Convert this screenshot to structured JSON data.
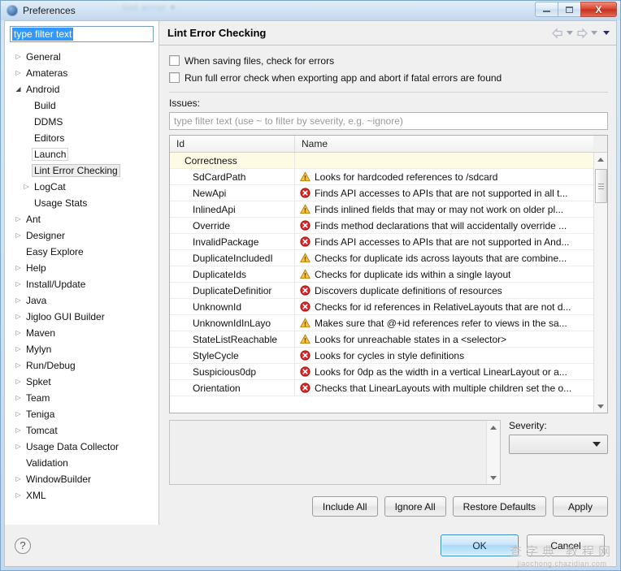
{
  "window": {
    "title": "Preferences",
    "ghost_text": "lint error  ▾",
    "minimize_label": "Minimize",
    "maximize_label": "Maximize",
    "close_label": "X"
  },
  "sidebar": {
    "filter_value": "type filter text",
    "items": [
      {
        "label": "General",
        "indent": 0,
        "arrow": "collapsed",
        "state": "normal"
      },
      {
        "label": "Amateras",
        "indent": 0,
        "arrow": "collapsed",
        "state": "normal"
      },
      {
        "label": "Android",
        "indent": 0,
        "arrow": "expanded",
        "state": "normal"
      },
      {
        "label": "Build",
        "indent": 1,
        "arrow": "none",
        "state": "normal"
      },
      {
        "label": "DDMS",
        "indent": 1,
        "arrow": "none",
        "state": "normal"
      },
      {
        "label": "Editors",
        "indent": 1,
        "arrow": "none",
        "state": "normal"
      },
      {
        "label": "Launch",
        "indent": 1,
        "arrow": "none",
        "state": "hover"
      },
      {
        "label": "Lint Error Checking",
        "indent": 1,
        "arrow": "none",
        "state": "selected"
      },
      {
        "label": "LogCat",
        "indent": 1,
        "arrow": "collapsed",
        "state": "normal"
      },
      {
        "label": "Usage Stats",
        "indent": 1,
        "arrow": "none",
        "state": "normal"
      },
      {
        "label": "Ant",
        "indent": 0,
        "arrow": "collapsed",
        "state": "normal"
      },
      {
        "label": "Designer",
        "indent": 0,
        "arrow": "collapsed",
        "state": "normal"
      },
      {
        "label": "Easy Explore",
        "indent": 0,
        "arrow": "none",
        "state": "normal"
      },
      {
        "label": "Help",
        "indent": 0,
        "arrow": "collapsed",
        "state": "normal"
      },
      {
        "label": "Install/Update",
        "indent": 0,
        "arrow": "collapsed",
        "state": "normal"
      },
      {
        "label": "Java",
        "indent": 0,
        "arrow": "collapsed",
        "state": "normal"
      },
      {
        "label": "Jigloo GUI Builder",
        "indent": 0,
        "arrow": "collapsed",
        "state": "normal"
      },
      {
        "label": "Maven",
        "indent": 0,
        "arrow": "collapsed",
        "state": "normal"
      },
      {
        "label": "Mylyn",
        "indent": 0,
        "arrow": "collapsed",
        "state": "normal"
      },
      {
        "label": "Run/Debug",
        "indent": 0,
        "arrow": "collapsed",
        "state": "normal"
      },
      {
        "label": "Spket",
        "indent": 0,
        "arrow": "collapsed",
        "state": "normal"
      },
      {
        "label": "Team",
        "indent": 0,
        "arrow": "collapsed",
        "state": "normal"
      },
      {
        "label": "Teniga",
        "indent": 0,
        "arrow": "collapsed",
        "state": "normal"
      },
      {
        "label": "Tomcat",
        "indent": 0,
        "arrow": "collapsed",
        "state": "normal"
      },
      {
        "label": "Usage Data Collector",
        "indent": 0,
        "arrow": "collapsed",
        "state": "normal"
      },
      {
        "label": "Validation",
        "indent": 0,
        "arrow": "none",
        "state": "normal"
      },
      {
        "label": "WindowBuilder",
        "indent": 0,
        "arrow": "collapsed",
        "state": "normal"
      },
      {
        "label": "XML",
        "indent": 0,
        "arrow": "collapsed",
        "state": "normal"
      }
    ]
  },
  "page": {
    "title": "Lint Error Checking",
    "nav": {
      "back": "back-arrow",
      "forward": "forward-arrow",
      "menu": "view-menu"
    },
    "checkboxes": [
      {
        "label": "When saving files, check for errors",
        "checked": false
      },
      {
        "label": "Run full error check when exporting app and abort if fatal errors are found",
        "checked": false
      }
    ],
    "issues_label": "Issues:",
    "issue_filter_placeholder": "type filter text (use ~ to filter by severity, e.g. ~ignore)",
    "table": {
      "columns": [
        "Id",
        "Name"
      ],
      "rows": [
        {
          "id": "Correctness",
          "severity": "group",
          "name": ""
        },
        {
          "id": "SdCardPath",
          "severity": "warning",
          "name": "Looks for hardcoded references to /sdcard"
        },
        {
          "id": "NewApi",
          "severity": "error",
          "name": "Finds API accesses to APIs that are not supported in all t..."
        },
        {
          "id": "InlinedApi",
          "severity": "warning",
          "name": "Finds inlined fields that may or may not work on older pl..."
        },
        {
          "id": "Override",
          "severity": "error",
          "name": "Finds method declarations that will accidentally override ..."
        },
        {
          "id": "InvalidPackage",
          "severity": "error",
          "name": "Finds API accesses to APIs that are not supported in And..."
        },
        {
          "id": "DuplicateIncludedI",
          "severity": "warning",
          "name": "Checks for duplicate ids across layouts that are combine..."
        },
        {
          "id": "DuplicateIds",
          "severity": "warning",
          "name": "Checks for duplicate ids within a single layout"
        },
        {
          "id": "DuplicateDefinitior",
          "severity": "error",
          "name": "Discovers duplicate definitions of resources"
        },
        {
          "id": "UnknownId",
          "severity": "error",
          "name": "Checks for id references in RelativeLayouts that are not d..."
        },
        {
          "id": "UnknownIdInLayo",
          "severity": "warning",
          "name": "Makes sure that @+id references refer to views in the sa..."
        },
        {
          "id": "StateListReachable",
          "severity": "warning",
          "name": "Looks for unreachable states in a <selector>"
        },
        {
          "id": "StyleCycle",
          "severity": "error",
          "name": "Looks for cycles in style definitions"
        },
        {
          "id": "Suspicious0dp",
          "severity": "error",
          "name": "Looks for 0dp as the width in a vertical LinearLayout or a..."
        },
        {
          "id": "Orientation",
          "severity": "error",
          "name": "Checks that LinearLayouts with multiple children set the o..."
        }
      ]
    },
    "description_text": "",
    "severity_label": "Severity:",
    "severity_value": "",
    "actions": [
      {
        "label": "Include All",
        "name": "include-all-button"
      },
      {
        "label": "Ignore All",
        "name": "ignore-all-button"
      },
      {
        "label": "Restore Defaults",
        "name": "restore-defaults-button"
      },
      {
        "label": "Apply",
        "name": "apply-button"
      }
    ]
  },
  "footer": {
    "help_glyph": "?",
    "ok_label": "OK",
    "cancel_label": "Cancel"
  },
  "watermark": {
    "main": "查字典 教程网",
    "sub": "jiaochong.chazidian.com"
  }
}
